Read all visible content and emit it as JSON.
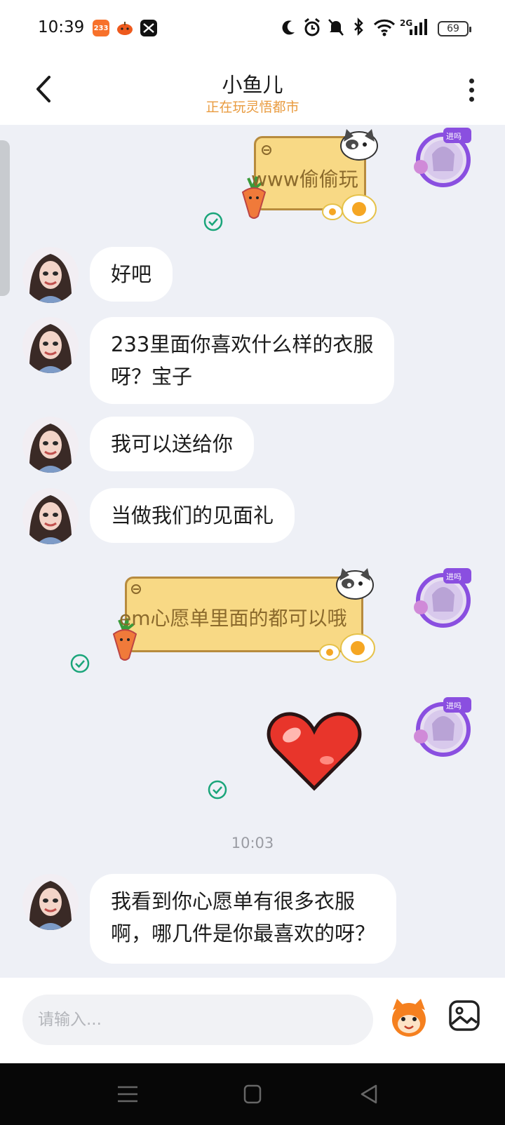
{
  "status_bar": {
    "time": "10:39",
    "app_icons": [
      "233-app-icon",
      "pumpkin-app-icon",
      "capcut-app-icon"
    ],
    "network": "2G",
    "battery": "69"
  },
  "header": {
    "title": "小鱼儿",
    "subtitle": "正在玩灵悟都市"
  },
  "messages": [
    {
      "from": "self",
      "type": "sticker",
      "text": "www偷偷玩"
    },
    {
      "from": "other",
      "type": "text",
      "lines": [
        "好吧"
      ]
    },
    {
      "from": "other",
      "type": "text",
      "lines": [
        "233里面你喜欢什么样的衣服",
        "呀？宝子"
      ]
    },
    {
      "from": "other",
      "type": "text",
      "lines": [
        "我可以送给你"
      ]
    },
    {
      "from": "other",
      "type": "text",
      "lines": [
        "当做我们的见面礼"
      ]
    },
    {
      "from": "self",
      "type": "sticker",
      "text": "em心愿单里面的都可以哦"
    },
    {
      "from": "self",
      "type": "emoji",
      "emoji": "heart"
    },
    {
      "type": "timestamp",
      "text": "10:03"
    },
    {
      "from": "other",
      "type": "text",
      "lines": [
        "我看到你心愿单有很多衣服",
        "啊，哪几件是你最喜欢的呀？"
      ]
    }
  ],
  "input": {
    "placeholder": "请输入..."
  },
  "colors": {
    "accent": "#e99b3f",
    "read_check": "#1aa57a",
    "sticker_bg": "#f8d985",
    "heart": "#e8352b"
  }
}
